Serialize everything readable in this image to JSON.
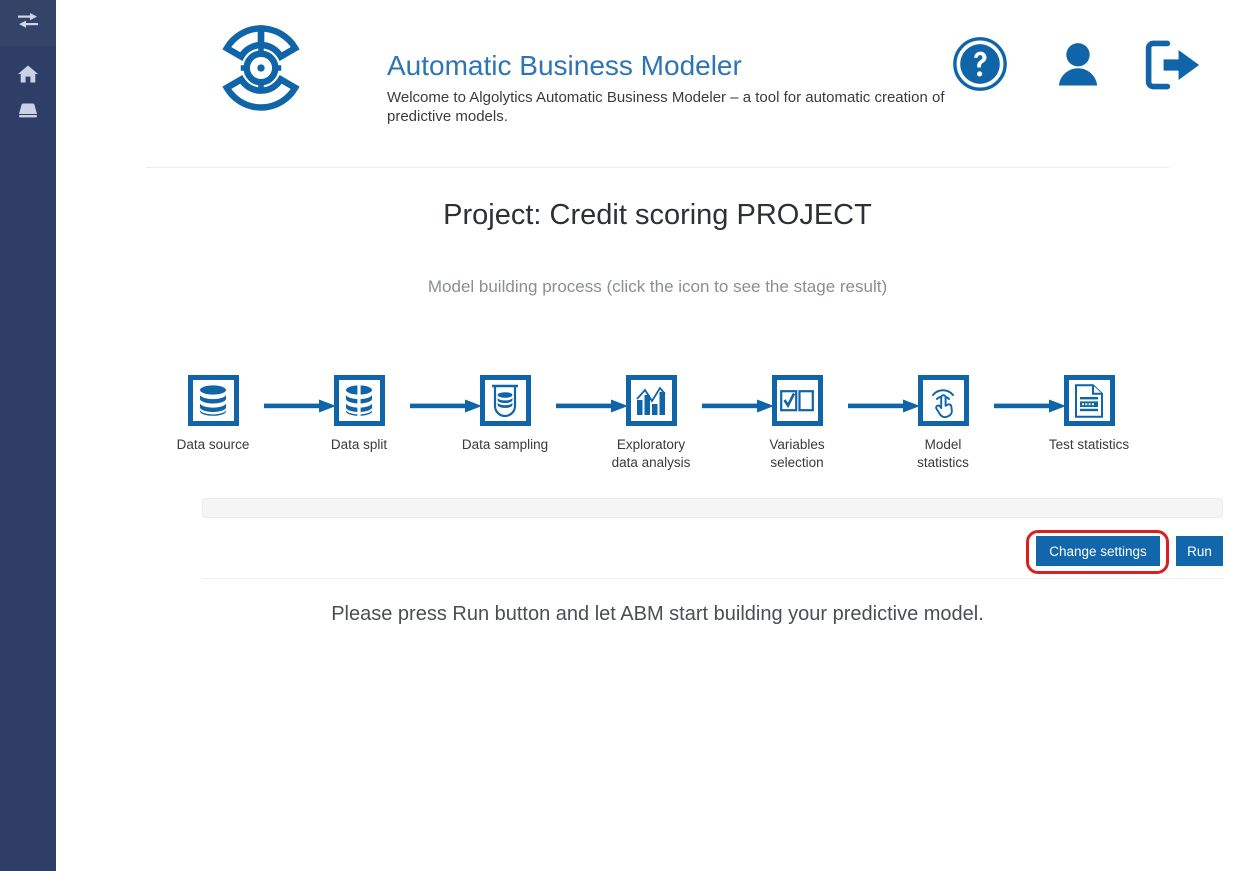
{
  "sidebar": {
    "toggle": {
      "name": "collapse-expand-toggle",
      "icon": "exchange-arrows-icon"
    },
    "items": [
      {
        "name": "home",
        "icon": "home-icon"
      },
      {
        "name": "database",
        "icon": "database-icon"
      }
    ]
  },
  "header": {
    "logo_icon": "abm-circular-logo",
    "title": "Automatic Business Modeler",
    "subtitle": "Welcome to Algolytics Automatic Business Modeler – a tool for automatic creation of predictive models.",
    "actions": [
      {
        "name": "help",
        "icon": "question-mark-circle-icon"
      },
      {
        "name": "user-account",
        "icon": "user-icon"
      },
      {
        "name": "logout",
        "icon": "logout-arrow-icon"
      }
    ]
  },
  "main": {
    "project_title": "Project: Credit scoring PROJECT",
    "process_caption": "Model building process (click the icon to see the stage result)",
    "stages": [
      {
        "label": "Data source",
        "icon": "database-stack-icon"
      },
      {
        "label": "Data split",
        "icon": "database-split-icon"
      },
      {
        "label": "Data sampling",
        "icon": "database-flask-icon"
      },
      {
        "label": "Exploratory\ndata analysis",
        "icon": "bar-chart-icon"
      },
      {
        "label": "Variables\nselection",
        "icon": "checkbox-pair-icon"
      },
      {
        "label": "Model\nstatistics",
        "icon": "hand-click-icon"
      },
      {
        "label": "Test statistics",
        "icon": "document-report-icon"
      }
    ],
    "progress": {
      "value": 0,
      "label": ""
    },
    "buttons": {
      "change_settings": "Change settings",
      "run": "Run"
    },
    "footer_message": "Please press Run button and let ABM start building your predictive model."
  },
  "colors": {
    "sidebar_bg": "#2f3e66",
    "brand_blue": "#1065a8",
    "title_blue": "#2e75b6",
    "button_blue": "#1267ac",
    "highlight_red": "#d82020"
  }
}
